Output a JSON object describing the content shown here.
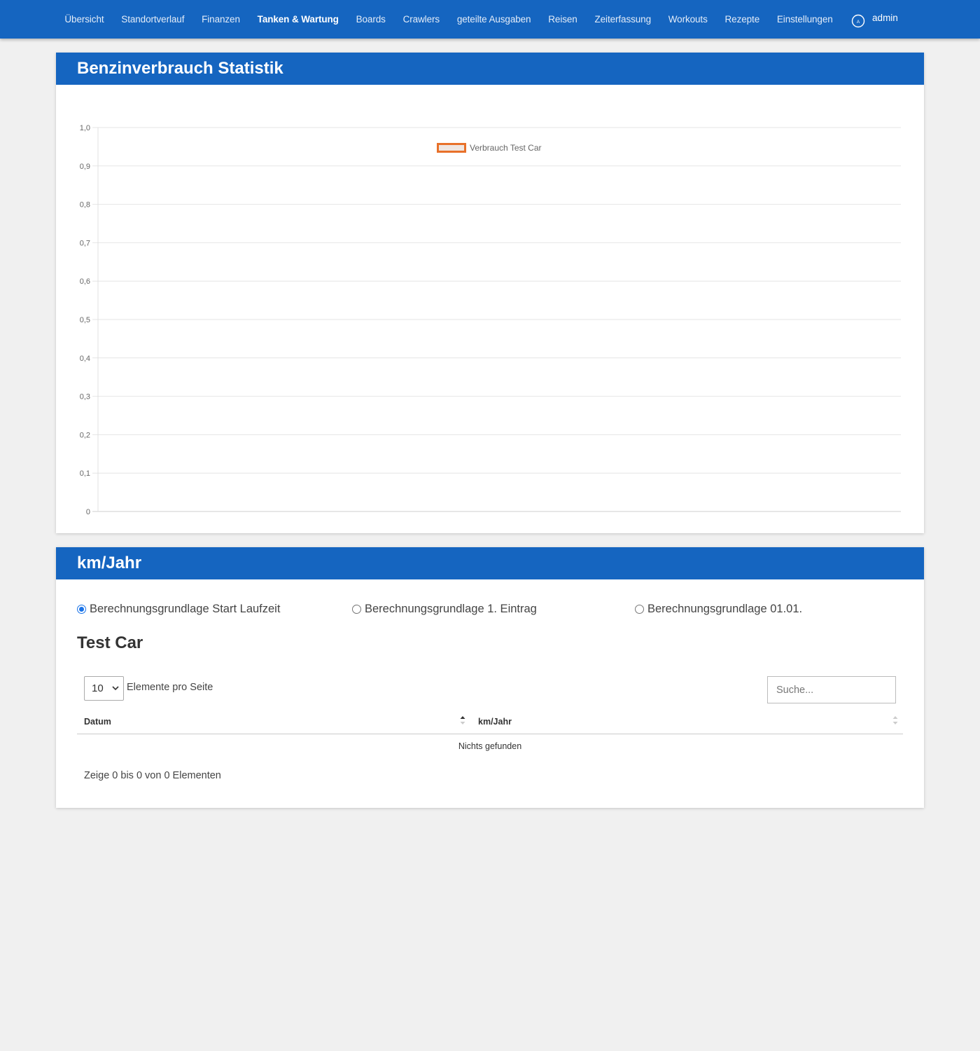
{
  "nav": {
    "items": [
      "Übersicht",
      "Standortverlauf",
      "Finanzen",
      "Tanken & Wartung",
      "Boards",
      "Crawlers",
      "geteilte Ausgaben",
      "Reisen",
      "Zeiterfassung",
      "Workouts",
      "Rezepte",
      "Einstellungen"
    ],
    "active_index": 3,
    "user_label": "admin",
    "user_icon": "user-circle-icon"
  },
  "stats_card": {
    "title": "Benzinverbrauch Statistik"
  },
  "chart_data": {
    "type": "line",
    "title": "",
    "xlabel": "",
    "ylabel": "",
    "x": [],
    "series": [
      {
        "name": "Verbrauch Test Car",
        "values": [],
        "color": "#e8712a"
      }
    ],
    "ylim": [
      0,
      1
    ],
    "yticks": [
      "0",
      "0,1",
      "0,2",
      "0,3",
      "0,4",
      "0,5",
      "0,6",
      "0,7",
      "0,8",
      "0,9",
      "1,0"
    ],
    "grid": true,
    "legend": "top-center"
  },
  "km_card": {
    "title": "km/Jahr",
    "radios": [
      {
        "label": "Berechnungsgrundlage Start Laufzeit",
        "checked": true
      },
      {
        "label": "Berechnungsgrundlage 1. Eintrag",
        "checked": false
      },
      {
        "label": "Berechnungsgrundlage 01.01.",
        "checked": false
      }
    ],
    "car_title": "Test Car",
    "page_length": "10",
    "page_length_label": "Elemente pro Seite",
    "search_placeholder": "Suche...",
    "columns": [
      "Datum",
      "km/Jahr"
    ],
    "empty_message": "Nichts gefunden",
    "info": "Zeige 0 bis 0 von 0 Elementen"
  },
  "colors": {
    "primary": "#1565c0",
    "series": "#e8712a",
    "background": "#f0f0f0"
  }
}
